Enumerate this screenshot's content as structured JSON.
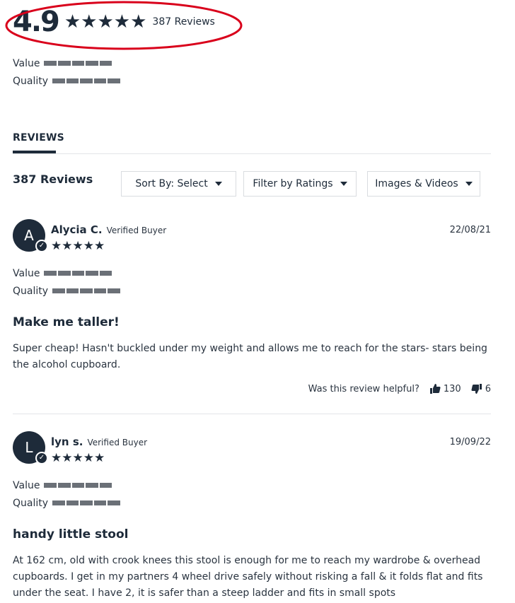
{
  "summary": {
    "average": "4.9",
    "stars": 5,
    "total_reviews": "387 Reviews",
    "highlight_color": "#d9001b"
  },
  "overall_factors": [
    {
      "label": "Value",
      "score_fraction": 1.0
    },
    {
      "label": "Quality",
      "score_fraction": 1.0
    }
  ],
  "tabs": {
    "reviews": "REVIEWS"
  },
  "toolbar": {
    "reviews_count": "387 Reviews",
    "sort": "Sort By: Select",
    "ratings_filter": "Filter by Ratings",
    "media_filter": "Images & Videos"
  },
  "reviews": [
    {
      "initial": "A",
      "author": "Alycia C.",
      "verified": "Verified Buyer",
      "date": "22/08/21",
      "stars": 5,
      "factors": [
        {
          "label": "Value",
          "score_fraction": 1.0
        },
        {
          "label": "Quality",
          "score_fraction": 1.0
        }
      ],
      "title": "Make me taller!",
      "body": "Super cheap! Hasn't buckled under my weight and allows me to reach for the stars- stars being the alcohol cupboard.",
      "helpful_question": "Was this review helpful?",
      "upvotes": "130",
      "downvotes": "6"
    },
    {
      "initial": "L",
      "author": "lyn s.",
      "verified": "Verified Buyer",
      "date": "19/09/22",
      "stars": 5,
      "factors": [
        {
          "label": "Value",
          "score_fraction": 1.0
        },
        {
          "label": "Quality",
          "score_fraction": 1.0
        }
      ],
      "title": "handy little stool",
      "body": "At 162 cm, old with crook knees this stool is enough for me to reach my wardrobe & overhead cupboards. I get in my partners 4 wheel drive safely without risking a fall & it folds flat and fits under the seat. I have 2, it is safer than a steep ladder and fits in small spots"
    }
  ],
  "colors": {
    "primary": "#1e2b3a",
    "bar": "#6b7077",
    "border": "#d9dce0"
  },
  "icons": {
    "star": "star-icon",
    "thumb_up": "thumbs-up-icon",
    "thumb_down": "thumbs-down-icon",
    "check": "check-icon",
    "caret": "caret-down-icon"
  }
}
